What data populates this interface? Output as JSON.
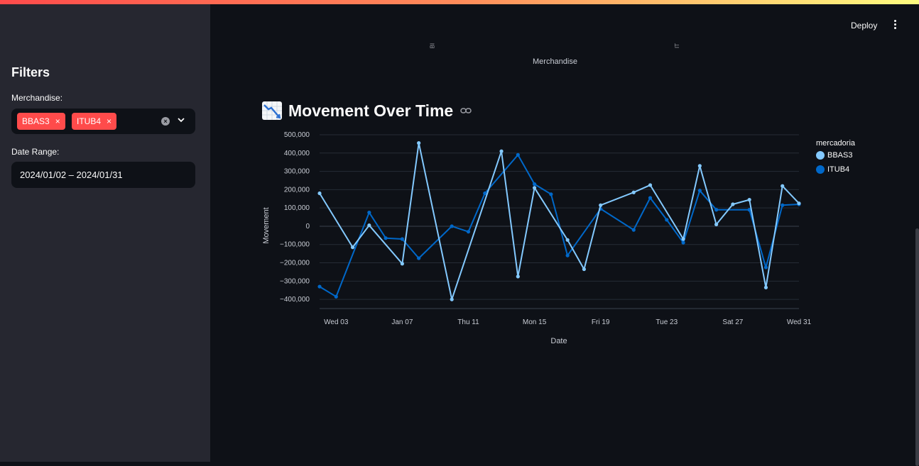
{
  "colors": {
    "accent": "#ff4b4b",
    "background": "#0e1117",
    "sidebar": "#262730",
    "series_bbas3": "#83c9ff",
    "series_itub4": "#0068c9",
    "grid": "#262c36"
  },
  "header": {
    "deploy_label": "Deploy",
    "menu_icon": "vertical-dots-icon"
  },
  "sidebar": {
    "title": "Filters",
    "merchandise_label": "Merchandise:",
    "selected_tags": [
      "BBAS3",
      "ITUB4"
    ],
    "tag_remove_glyph": "×",
    "date_range_label": "Date Range:",
    "date_range_value": "2024/01/02 – 2024/01/31"
  },
  "previous_chart": {
    "tick_labels": [
      "BI",
      "IT"
    ],
    "axis_title": "Merchandise"
  },
  "section": {
    "icon": "chart-decreasing-icon",
    "title": "Movement Over Time",
    "link_icon": "link-icon"
  },
  "chart_data": {
    "type": "line",
    "xlabel": "Date",
    "ylabel": "Movement",
    "legend_title": "mercadoria",
    "legend_position": "right",
    "grid": true,
    "x": [
      "2024-01-02",
      "2024-01-03",
      "2024-01-04",
      "2024-01-05",
      "2024-01-06",
      "2024-01-07",
      "2024-01-08",
      "2024-01-09",
      "2024-01-10",
      "2024-01-11",
      "2024-01-12",
      "2024-01-13",
      "2024-01-14",
      "2024-01-15",
      "2024-01-16",
      "2024-01-17",
      "2024-01-18",
      "2024-01-19",
      "2024-01-20",
      "2024-01-21",
      "2024-01-22",
      "2024-01-23",
      "2024-01-24",
      "2024-01-25",
      "2024-01-26",
      "2024-01-27",
      "2024-01-28",
      "2024-01-29",
      "2024-01-30",
      "2024-01-31"
    ],
    "x_tick_labels": [
      "Wed 03",
      "Jan 07",
      "Thu 11",
      "Mon 15",
      "Fri 19",
      "Tue 23",
      "Sat 27",
      "Wed 31"
    ],
    "x_tick_dates": [
      "2024-01-03",
      "2024-01-07",
      "2024-01-11",
      "2024-01-15",
      "2024-01-19",
      "2024-01-23",
      "2024-01-27",
      "2024-01-31"
    ],
    "y_ticks": [
      500000,
      400000,
      300000,
      200000,
      100000,
      0,
      -100000,
      -200000,
      -300000,
      -400000
    ],
    "y_tick_labels": [
      "500,000",
      "400,000",
      "300,000",
      "200,000",
      "100,000",
      "0",
      "−100,000",
      "−200,000",
      "−300,000",
      "−400,000"
    ],
    "ylim": [
      -400000,
      500000
    ],
    "series": [
      {
        "name": "BBAS3",
        "points": [
          [
            "2024-01-02",
            180000
          ],
          [
            "2024-01-04",
            -115000
          ],
          [
            "2024-01-05",
            5000
          ],
          [
            "2024-01-07",
            -205000
          ],
          [
            "2024-01-08",
            455000
          ],
          [
            "2024-01-10",
            -400000
          ],
          [
            "2024-01-13",
            410000
          ],
          [
            "2024-01-14",
            -275000
          ],
          [
            "2024-01-15",
            210000
          ],
          [
            "2024-01-17",
            -75000
          ],
          [
            "2024-01-18",
            -235000
          ],
          [
            "2024-01-19",
            115000
          ],
          [
            "2024-01-21",
            185000
          ],
          [
            "2024-01-22",
            225000
          ],
          [
            "2024-01-24",
            -70000
          ],
          [
            "2024-01-25",
            330000
          ],
          [
            "2024-01-26",
            10000
          ],
          [
            "2024-01-27",
            120000
          ],
          [
            "2024-01-28",
            145000
          ],
          [
            "2024-01-29",
            -335000
          ],
          [
            "2024-01-30",
            220000
          ],
          [
            "2024-01-31",
            125000
          ]
        ]
      },
      {
        "name": "ITUB4",
        "points": [
          [
            "2024-01-02",
            -330000
          ],
          [
            "2024-01-03",
            -385000
          ],
          [
            "2024-01-05",
            75000
          ],
          [
            "2024-01-06",
            -65000
          ],
          [
            "2024-01-07",
            -70000
          ],
          [
            "2024-01-08",
            -175000
          ],
          [
            "2024-01-10",
            0
          ],
          [
            "2024-01-11",
            -30000
          ],
          [
            "2024-01-12",
            180000
          ],
          [
            "2024-01-14",
            390000
          ],
          [
            "2024-01-15",
            230000
          ],
          [
            "2024-01-16",
            175000
          ],
          [
            "2024-01-17",
            -160000
          ],
          [
            "2024-01-19",
            95000
          ],
          [
            "2024-01-21",
            -20000
          ],
          [
            "2024-01-22",
            155000
          ],
          [
            "2024-01-23",
            35000
          ],
          [
            "2024-01-24",
            -90000
          ],
          [
            "2024-01-25",
            195000
          ],
          [
            "2024-01-26",
            90000
          ],
          [
            "2024-01-28",
            90000
          ],
          [
            "2024-01-29",
            -225000
          ],
          [
            "2024-01-30",
            115000
          ],
          [
            "2024-01-31",
            120000
          ]
        ]
      }
    ]
  }
}
